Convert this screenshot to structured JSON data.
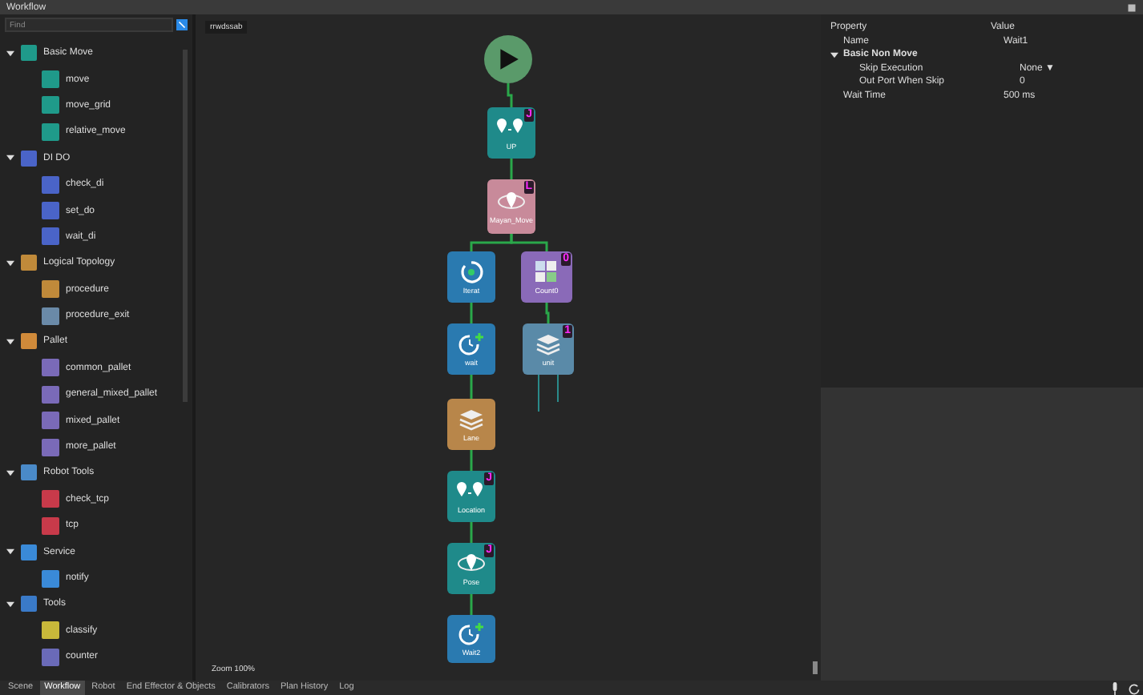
{
  "window": {
    "title": "Workflow"
  },
  "library": {
    "search": {
      "placeholder": "Find"
    },
    "groups": [
      {
        "label": "Basic Move",
        "color": "#1f9a8a",
        "expanded": true,
        "children": [
          {
            "label": "move",
            "color": "#1f9a8a"
          },
          {
            "label": "move_grid",
            "color": "#1f9a8a"
          },
          {
            "label": "relative_move",
            "color": "#1f9a8a"
          }
        ]
      },
      {
        "label": "DI DO",
        "color": "#4a64c8",
        "expanded": true,
        "children": [
          {
            "label": "check_di",
            "color": "#4a64c8"
          },
          {
            "label": "set_do",
            "color": "#4a64c8"
          },
          {
            "label": "wait_di",
            "color": "#4a64c8"
          }
        ]
      },
      {
        "label": "Logical Topology",
        "color": "#c08a3a",
        "expanded": true,
        "children": [
          {
            "label": "procedure",
            "color": "#c08a3a"
          },
          {
            "label": "procedure_exit",
            "color": "#6a8aa8"
          }
        ]
      },
      {
        "label": "Pallet",
        "color": "#d08a3a",
        "expanded": true,
        "children": [
          {
            "label": "common_pallet",
            "color": "#7a6ab8"
          },
          {
            "label": "general_mixed_pallet",
            "color": "#7a6ab8"
          },
          {
            "label": "mixed_pallet",
            "color": "#7a6ab8"
          },
          {
            "label": "more_pallet",
            "color": "#7a6ab8"
          }
        ]
      },
      {
        "label": "Robot Tools",
        "color": "#4a8ac8",
        "expanded": true,
        "children": [
          {
            "label": "check_tcp",
            "color": "#c83a4a"
          },
          {
            "label": "tcp",
            "color": "#c83a4a"
          }
        ]
      },
      {
        "label": "Service",
        "color": "#3a8ad8",
        "expanded": true,
        "children": [
          {
            "label": "notify",
            "color": "#3a8ad8"
          }
        ]
      },
      {
        "label": "Tools",
        "color": "#3a7ac8",
        "expanded": true,
        "children": [
          {
            "label": "classify",
            "color": "#c8b83a"
          },
          {
            "label": "counter",
            "color": "#6a6ab8"
          }
        ]
      }
    ]
  },
  "canvas": {
    "tab": "rrwdssab",
    "zoom": "Zoom 100%",
    "nodes": [
      {
        "kind": "start",
        "color": "#5a9a6a"
      },
      {
        "kind": "move",
        "label": "UP",
        "badge": "J",
        "color": "#1f8a8a"
      },
      {
        "kind": "path",
        "label": "Mayan_Move",
        "badge": "L",
        "color": "#c88a9a"
      },
      {
        "kind": "loop",
        "label": "Iterat",
        "color": "#2a7ab0"
      },
      {
        "kind": "counter",
        "label": "Count0",
        "badge": "0",
        "color": "#8a6ab8"
      },
      {
        "kind": "wait",
        "label": "wait",
        "color": "#2a7ab0"
      },
      {
        "kind": "stack",
        "label": "unit",
        "badge": "1",
        "color": "#5a8aa8"
      },
      {
        "kind": "stack",
        "label": "Lane",
        "color": "#b8864a"
      },
      {
        "kind": "move",
        "label": "Location",
        "badge": "J",
        "color": "#1f8a8a"
      },
      {
        "kind": "path",
        "label": "Pose",
        "badge": "J",
        "color": "#1f8a8a"
      },
      {
        "kind": "wait",
        "label": "Wait2",
        "color": "#2a7ab0"
      }
    ]
  },
  "properties": {
    "columns": [
      "Property",
      "Value"
    ],
    "rows": [
      {
        "kind": "row",
        "name": "Name",
        "value": "Wait1"
      },
      {
        "kind": "group",
        "name": "Basic Non Move",
        "expanded": true
      },
      {
        "kind": "row",
        "name": "Skip Execution",
        "value": "None ▼",
        "indent": true
      },
      {
        "kind": "row",
        "name": "Out Port When Skip",
        "value": "0",
        "indent": true
      },
      {
        "kind": "row",
        "name": "Wait Time",
        "value": "500 ms"
      }
    ]
  },
  "bottom_tabs": [
    {
      "label": "Scene",
      "selected": false
    },
    {
      "label": "Workflow",
      "selected": true
    },
    {
      "label": "Robot",
      "selected": false
    },
    {
      "label": "End Effector & Objects",
      "selected": false
    },
    {
      "label": "Calibrators",
      "selected": false
    },
    {
      "label": "Plan History",
      "selected": false
    },
    {
      "label": "Log",
      "selected": false
    }
  ]
}
